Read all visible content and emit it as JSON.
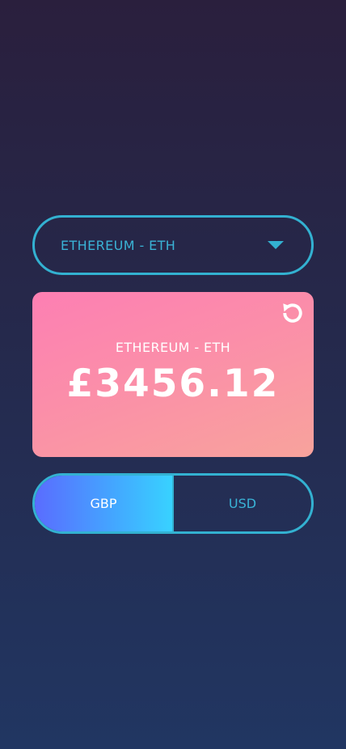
{
  "currency_select": {
    "selected": "ETHEREUM - ETH"
  },
  "price_card": {
    "name": "ETHEREUM - ETH",
    "price": "£3456.12",
    "refresh_icon": "refresh-icon"
  },
  "fiat_toggle": {
    "options": [
      {
        "label": "GBP",
        "active": true
      },
      {
        "label": "USD",
        "active": false
      }
    ]
  },
  "colors": {
    "accent": "#33b1d1",
    "card_gradient_start": "#fd7fb3",
    "card_gradient_end": "#f8a39c",
    "toggle_gradient_start": "#5a6cff",
    "toggle_gradient_end": "#38d2ff"
  }
}
